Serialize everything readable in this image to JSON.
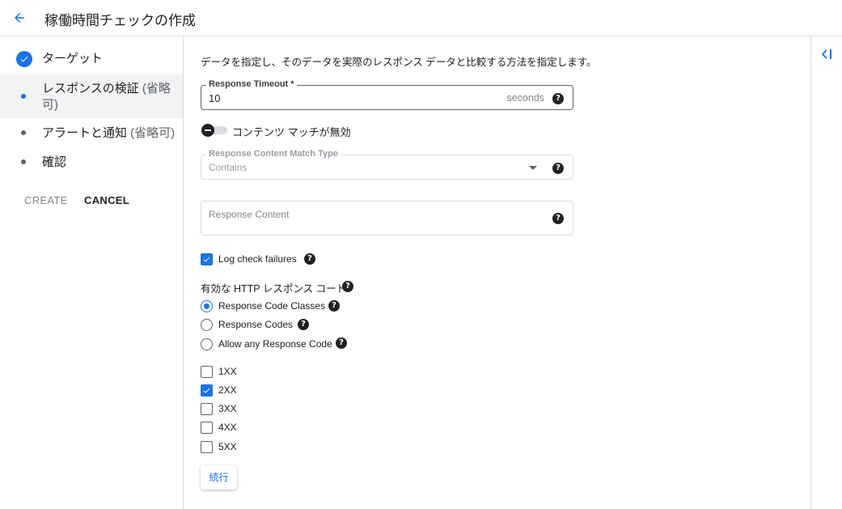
{
  "header": {
    "title": "稼働時間チェックの作成"
  },
  "stepper": {
    "steps": [
      {
        "label": "ターゲット",
        "optional": ""
      },
      {
        "label": "レスポンスの検証 ",
        "optional": "(省略",
        "optional2": "可)"
      },
      {
        "label": "アラートと通知 ",
        "optional": "(省略可)"
      },
      {
        "label": "確認",
        "optional": ""
      }
    ],
    "create_label": "CREATE",
    "cancel_label": "CANCEL"
  },
  "main": {
    "intro": "データを指定し、そのデータを実際のレスポンス データと比較する方法を指定します。",
    "timeout": {
      "label": "Response Timeout *",
      "value": "10",
      "suffix": "seconds"
    },
    "content_match_toggle": {
      "label": "コンテンツ マッチが無効",
      "enabled": false
    },
    "match_type": {
      "label": "Response Content Match Type",
      "value": "Contains"
    },
    "response_content": {
      "placeholder": "Response Content"
    },
    "log_failures": {
      "label": "Log check failures",
      "checked": true
    },
    "http_codes": {
      "title": "有効な HTTP レスポンス コード",
      "radios": [
        {
          "label": "Response Code Classes",
          "checked": true
        },
        {
          "label": "Response Codes",
          "checked": false
        },
        {
          "label": "Allow any Response Code",
          "checked": false
        }
      ],
      "classes": [
        {
          "label": "1XX",
          "checked": false
        },
        {
          "label": "2XX",
          "checked": true
        },
        {
          "label": "3XX",
          "checked": false
        },
        {
          "label": "4XX",
          "checked": false
        },
        {
          "label": "5XX",
          "checked": false
        }
      ]
    },
    "continue_label": "続行"
  },
  "help_glyph": "?",
  "colors": {
    "accent": "#1a73e8",
    "text": "#202124",
    "muted": "#5f6368",
    "border": "#dadce0"
  }
}
